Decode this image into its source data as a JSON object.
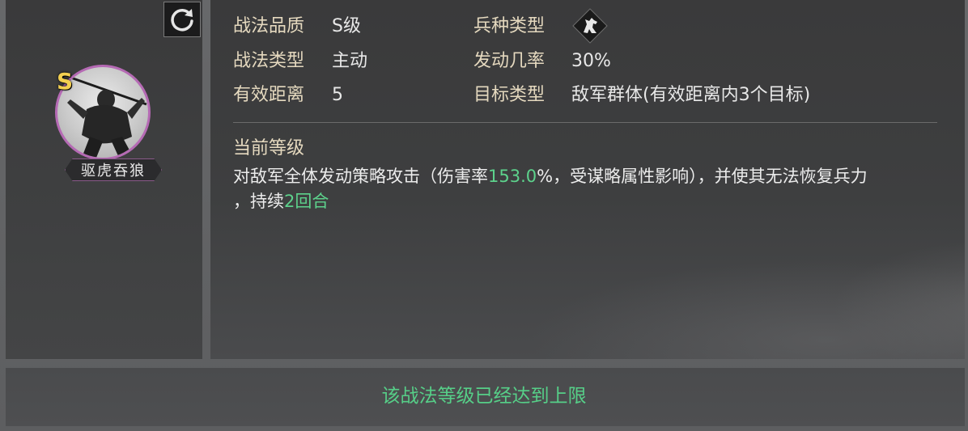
{
  "skill": {
    "grade_letter": "S",
    "name": "驱虎吞狼"
  },
  "attributes": {
    "quality_label": "战法品质",
    "quality_value": "S级",
    "troop_label": "兵种类型",
    "troop_icon": "horse-cavalry-icon",
    "type_label": "战法类型",
    "type_value": "主动",
    "rate_label": "发动几率",
    "rate_value": "30%",
    "range_label": "有效距离",
    "range_value": "5",
    "target_label": "目标类型",
    "target_value": "敌军群体(有效距离内3个目标)"
  },
  "description": {
    "level_title": "当前等级",
    "part1": "对敌军全体发动策略攻击（伤害率",
    "damage_rate": "153.0",
    "part2": "%，受谋略属性影响），并使其无法恢复兵力",
    "part3": "，持续",
    "duration": "2回合"
  },
  "footer": {
    "message": "该战法等级已经达到上限"
  },
  "colors": {
    "label": "#e5d9bf",
    "value": "#e8e8e8",
    "highlight": "#5dd28c",
    "border_purple": "#b56ab4",
    "grade_gold": "#f2cf50"
  }
}
